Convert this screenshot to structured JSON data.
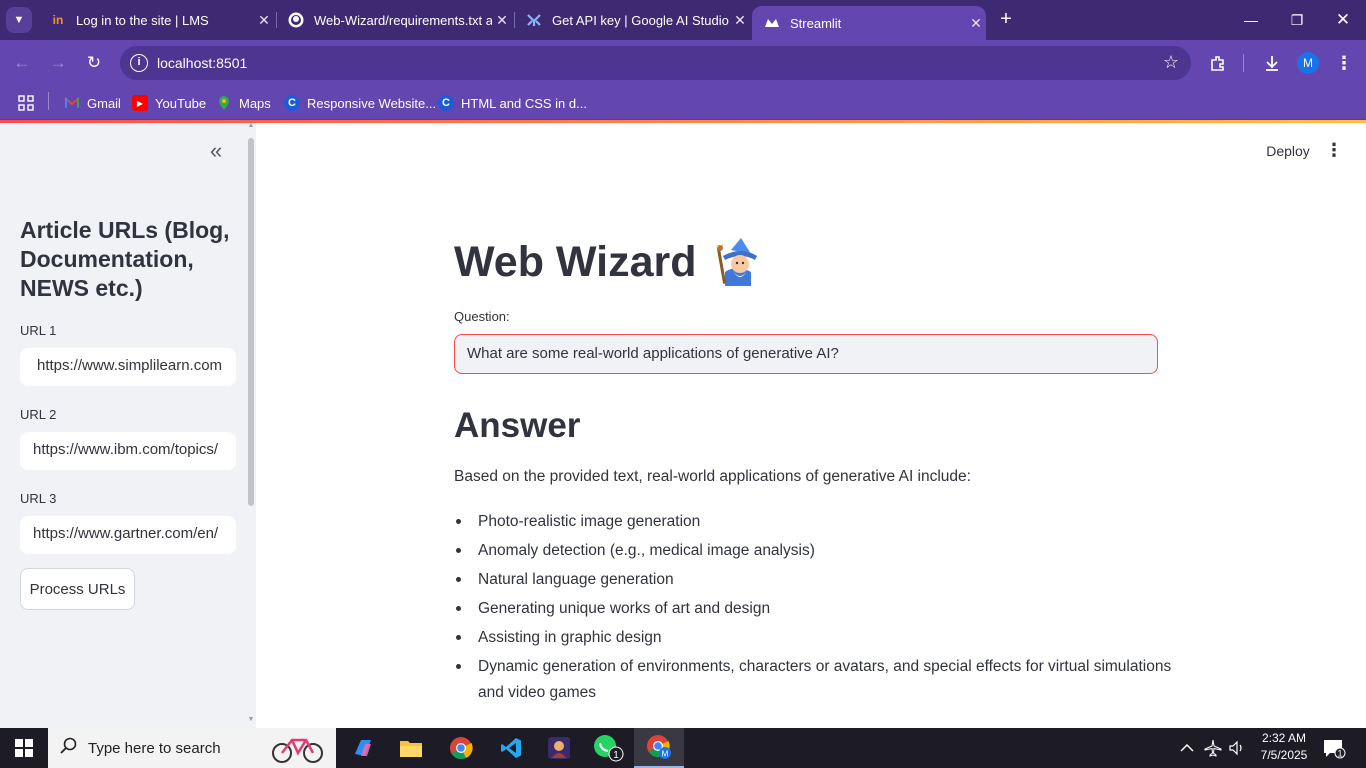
{
  "browser": {
    "tabs": [
      {
        "title": "Log in to the site | LMS",
        "favicon": "in"
      },
      {
        "title": "Web-Wizard/requirements.txt a",
        "favicon": "github-icon"
      },
      {
        "title": "Get API key | Google AI Studio",
        "favicon": "ai-studio-icon"
      },
      {
        "title": "Streamlit",
        "favicon": "streamlit-icon"
      }
    ],
    "url": "localhost:8501",
    "profile_initial": "M",
    "bookmarks": [
      {
        "label": "Gmail",
        "icon": "gmail-icon"
      },
      {
        "label": "YouTube",
        "icon": "youtube-icon"
      },
      {
        "label": "Maps",
        "icon": "maps-icon"
      },
      {
        "label": "Responsive Website...",
        "icon": "c-icon"
      },
      {
        "label": "HTML and CSS in d...",
        "icon": "c-icon"
      }
    ]
  },
  "sidebar": {
    "title": "Article URLs (Blog, Documentation, NEWS etc.)",
    "urls": [
      {
        "label": "URL 1",
        "value": "https://www.simplilearn.com"
      },
      {
        "label": "URL 2",
        "value": "https://www.ibm.com/topics/"
      },
      {
        "label": "URL 3",
        "value": "https://www.gartner.com/en/"
      }
    ],
    "process_button": "Process URLs"
  },
  "header": {
    "deploy": "Deploy"
  },
  "main": {
    "title": "Web Wizard",
    "question_label": "Question:",
    "question_value": "What are some real-world applications of generative AI?",
    "answer_heading": "Answer",
    "answer_intro": "Based on the provided text, real-world applications of generative AI include:",
    "answer_items": [
      "Photo-realistic image generation",
      "Anomaly detection (e.g., medical image analysis)",
      "Natural language generation",
      "Generating unique works of art and design",
      "Assisting in graphic design",
      "Dynamic generation of environments, characters or avatars, and special effects for virtual simulations and video games"
    ]
  },
  "taskbar": {
    "search_placeholder": "Type here to search",
    "time": "2:32 AM",
    "date": "7/5/2025",
    "notification_count": "1",
    "whatsapp_badge": "1"
  },
  "colors": {
    "chrome_dark": "#3e2a73",
    "chrome_light": "#6446b0",
    "streamlit_red": "#ff4b4b",
    "sidebar_bg": "#f0f2f6",
    "text": "#31333f"
  }
}
